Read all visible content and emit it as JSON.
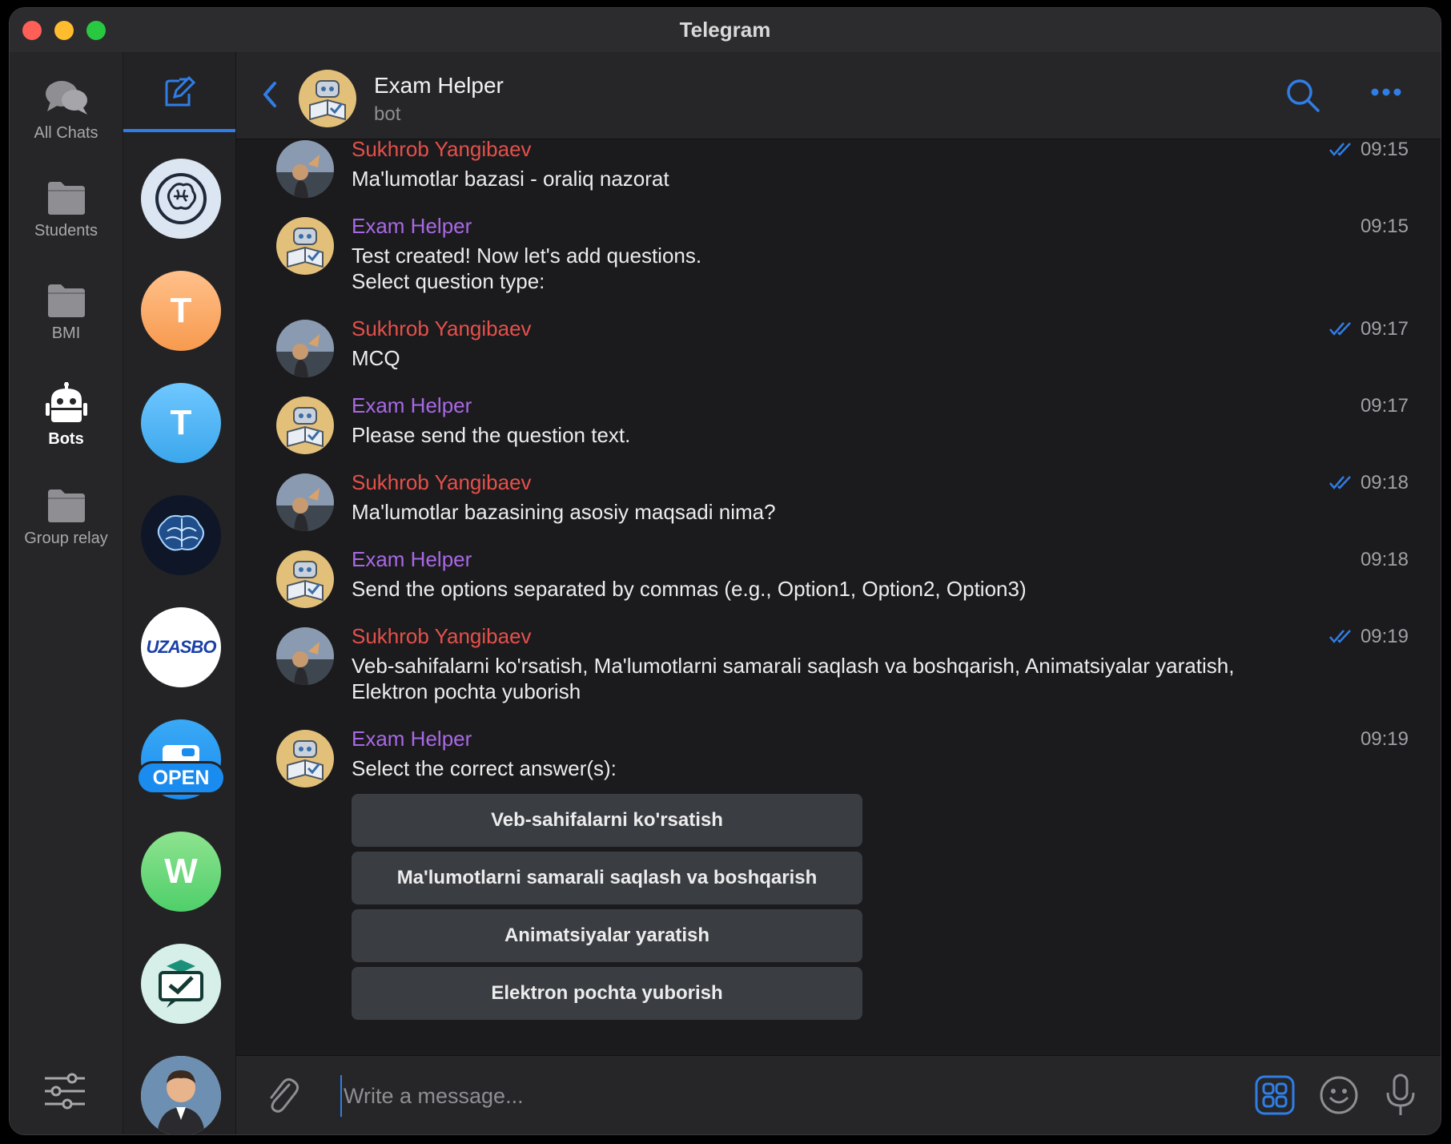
{
  "window": {
    "title": "Telegram"
  },
  "folders": [
    {
      "label": "All Chats",
      "icon": "chats-icon",
      "active": false
    },
    {
      "label": "Students",
      "icon": "folder-icon",
      "active": false
    },
    {
      "label": "BMI",
      "icon": "folder-icon",
      "active": false
    },
    {
      "label": "Bots",
      "icon": "bot-icon",
      "active": true
    },
    {
      "label": "Group relay",
      "icon": "folder-icon",
      "active": false
    }
  ],
  "chat_list": {
    "avatars": [
      {
        "name": "brain-line-avatar",
        "letter": ""
      },
      {
        "name": "orange-t-avatar",
        "letter": "T"
      },
      {
        "name": "blue-t-avatar",
        "letter": "T"
      },
      {
        "name": "brain-blue-avatar",
        "letter": ""
      },
      {
        "name": "uzasbo-avatar",
        "letter": "UZASBO"
      },
      {
        "name": "open-avatar",
        "letter": "OPEN"
      },
      {
        "name": "green-w-avatar",
        "letter": "W"
      },
      {
        "name": "exam-check-avatar",
        "letter": ""
      },
      {
        "name": "person-avatar",
        "letter": ""
      }
    ]
  },
  "header": {
    "name": "Exam Helper",
    "status": "bot"
  },
  "messages": [
    {
      "sender": "Sukhrob Yangibaev",
      "kind": "user",
      "time": "09:15",
      "text": "Ma'lumotlar bazasi - oraliq nazorat"
    },
    {
      "sender": "Exam Helper",
      "kind": "bot",
      "time": "09:15",
      "text": "Test created! Now let's add questions.",
      "text2": "Select question type:"
    },
    {
      "sender": "Sukhrob Yangibaev",
      "kind": "user",
      "time": "09:17",
      "text": "MCQ"
    },
    {
      "sender": "Exam Helper",
      "kind": "bot",
      "time": "09:17",
      "text": "Please send the question text."
    },
    {
      "sender": "Sukhrob Yangibaev",
      "kind": "user",
      "time": "09:18",
      "text": "Ma'lumotlar bazasining asosiy maqsadi nima?"
    },
    {
      "sender": "Exam Helper",
      "kind": "bot",
      "time": "09:18",
      "text": "Send the options separated by commas (e.g., Option1, Option2, Option3)"
    },
    {
      "sender": "Sukhrob Yangibaev",
      "kind": "user",
      "time": "09:19",
      "text": "Veb-sahifalarni ko'rsatish, Ma'lumotlarni samarali saqlash va boshqarish, Animatsiyalar yaratish,",
      "text2": "Elektron pochta yuborish"
    },
    {
      "sender": "Exam Helper",
      "kind": "bot",
      "time": "09:19",
      "text": "Select the correct answer(s):"
    }
  ],
  "keyboard": [
    "Veb-sahifalarni ko'rsatish",
    "Ma'lumotlarni samarali saqlash va boshqarish",
    "Animatsiyalar yaratish",
    "Elektron pochta yuborish"
  ],
  "composer": {
    "placeholder": "Write a message..."
  },
  "colors": {
    "accent": "#2f7ee6",
    "user_name": "#e5504b",
    "bot_name": "#a968e6"
  }
}
